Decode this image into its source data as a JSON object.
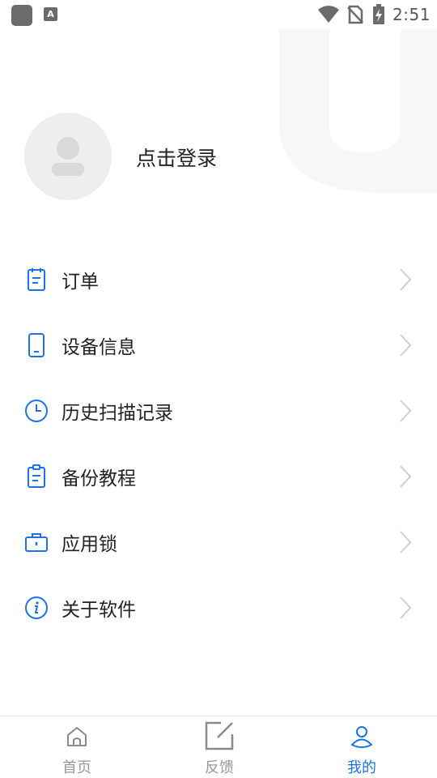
{
  "status_bar": {
    "time": "2:51",
    "notif_letter": "A"
  },
  "profile": {
    "login_label": "点击登录"
  },
  "menu": {
    "items": [
      {
        "label": "订单",
        "icon": "order-icon"
      },
      {
        "label": "设备信息",
        "icon": "device-icon"
      },
      {
        "label": "历史扫描记录",
        "icon": "clock-icon"
      },
      {
        "label": "备份教程",
        "icon": "clipboard-icon"
      },
      {
        "label": "应用锁",
        "icon": "briefcase-icon"
      },
      {
        "label": "关于软件",
        "icon": "info-icon"
      }
    ]
  },
  "bottom_nav": {
    "items": [
      {
        "label": "首页",
        "icon": "home-icon",
        "active": false
      },
      {
        "label": "反馈",
        "icon": "edit-icon",
        "active": false
      },
      {
        "label": "我的",
        "icon": "user-icon",
        "active": true
      }
    ]
  },
  "colors": {
    "accent": "#1a73e8",
    "muted": "#999999",
    "avatar_bg": "#eeeeee"
  }
}
